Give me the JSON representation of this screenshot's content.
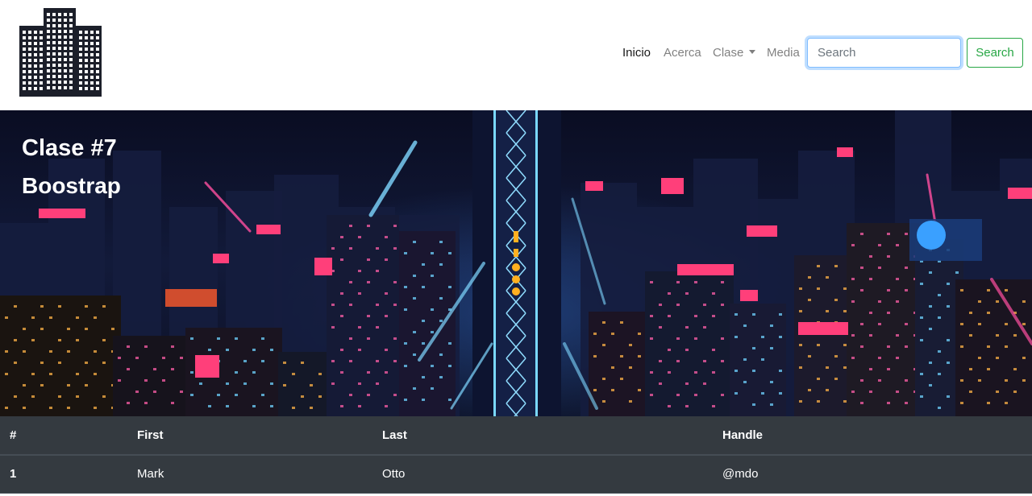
{
  "nav": {
    "links": [
      {
        "label": "Inicio"
      },
      {
        "label": "Acerca"
      },
      {
        "label": "Clase"
      },
      {
        "label": "Media"
      }
    ],
    "search": {
      "placeholder": "Search",
      "button_label": "Search"
    }
  },
  "hero": {
    "title": "Clase #7",
    "subtitle": "Boostrap"
  },
  "table": {
    "headers": [
      "#",
      "First",
      "Last",
      "Handle"
    ],
    "rows": [
      [
        "1",
        "Mark",
        "Otto",
        "@mdo"
      ]
    ]
  },
  "colors": {
    "navbar_bg": "#ffffff",
    "table_bg": "#343a40",
    "accent_success": "#28a745",
    "focus_border": "#80bdff"
  },
  "icons": {
    "logo": "city-buildings-icon",
    "dropdown": "caret-down-icon"
  }
}
